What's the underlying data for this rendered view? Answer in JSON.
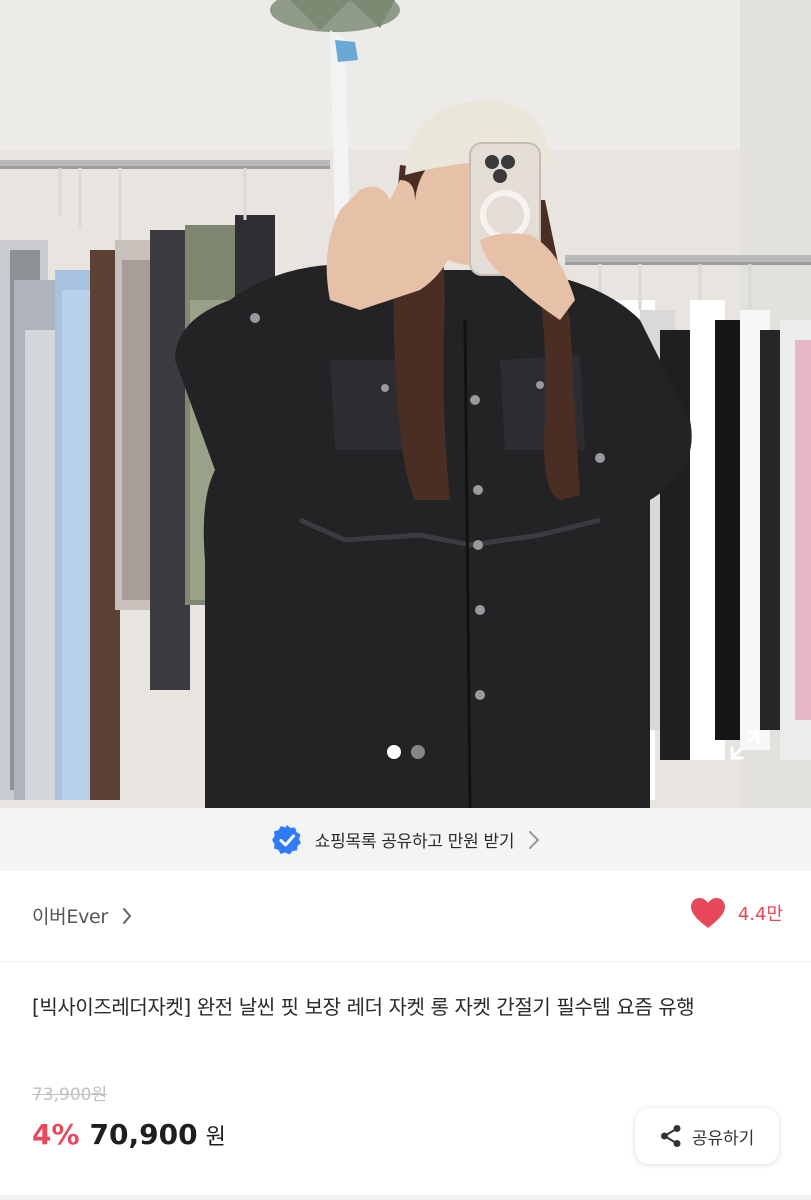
{
  "hero": {
    "image_name": "product-photo",
    "carousel": {
      "total": 2,
      "active": 1
    }
  },
  "share_banner": {
    "text": "쇼핑목록 공유하고 만원 받기",
    "badge_color": "#2f7cf6"
  },
  "store": {
    "name": "이버Ever",
    "likes": "4.4만",
    "heart_color": "#e8485b"
  },
  "product": {
    "title": "[빅사이즈레더자켓] 완전 날씬 핏 보장 레더 자켓 롱 자켓 간절기 필수템 요즘 유행",
    "original_price": "73,900원",
    "discount": "4%",
    "price": "70,900",
    "currency": "원"
  },
  "actions": {
    "share_label": "공유하기"
  }
}
